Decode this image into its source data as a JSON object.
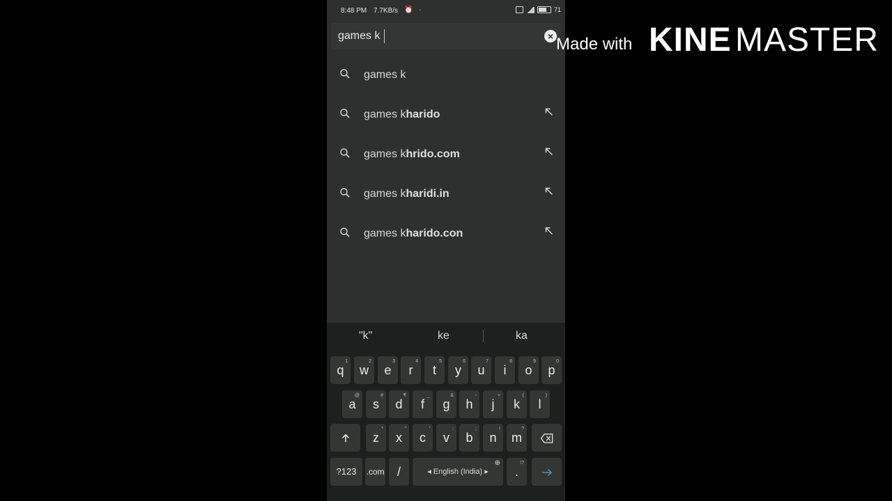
{
  "status_bar": {
    "time": "8:48 PM",
    "network_speed": "7.7KB/s",
    "battery": "71"
  },
  "search": {
    "query": "games k",
    "clear_icon": "close-circle-icon"
  },
  "suggestions": [
    {
      "prefix": "games k",
      "completion": "",
      "show_arrow": false
    },
    {
      "prefix": "games k",
      "completion": "harido",
      "show_arrow": true
    },
    {
      "prefix": "games k",
      "completion": "hrido.com",
      "show_arrow": true
    },
    {
      "prefix": "games k",
      "completion": "haridi.in",
      "show_arrow": true
    },
    {
      "prefix": "games k",
      "completion": "harido.con",
      "show_arrow": true
    }
  ],
  "keyboard": {
    "candidates": [
      "\"k\"",
      "ke",
      "ka"
    ],
    "row1": [
      {
        "key": "q",
        "sub": "1"
      },
      {
        "key": "w",
        "sub": "2"
      },
      {
        "key": "e",
        "sub": "3"
      },
      {
        "key": "r",
        "sub": "4"
      },
      {
        "key": "t",
        "sub": "5"
      },
      {
        "key": "y",
        "sub": "6"
      },
      {
        "key": "u",
        "sub": "7"
      },
      {
        "key": "i",
        "sub": "8"
      },
      {
        "key": "o",
        "sub": "9"
      },
      {
        "key": "p",
        "sub": "0"
      }
    ],
    "row2": [
      {
        "key": "a",
        "sub": "@"
      },
      {
        "key": "s",
        "sub": "#"
      },
      {
        "key": "d",
        "sub": "₹"
      },
      {
        "key": "f",
        "sub": "_"
      },
      {
        "key": "g",
        "sub": "&"
      },
      {
        "key": "h",
        "sub": "-"
      },
      {
        "key": "j",
        "sub": "+"
      },
      {
        "key": "k",
        "sub": "("
      },
      {
        "key": "l",
        "sub": ")"
      }
    ],
    "row3": [
      {
        "key": "z",
        "sub": "*"
      },
      {
        "key": "x",
        "sub": "\""
      },
      {
        "key": "c",
        "sub": "'"
      },
      {
        "key": "v",
        "sub": ":"
      },
      {
        "key": "b",
        "sub": ";"
      },
      {
        "key": "n",
        "sub": "!"
      },
      {
        "key": "m",
        "sub": "?"
      }
    ],
    "shift_icon": "shift-arrow-icon",
    "backspace_icon": "backspace-icon",
    "symbols_label": "?123",
    "com_label": ".com",
    "slash_label": "/",
    "space_label": "English (India)",
    "period_label": ".",
    "period_sub": "!?",
    "enter_icon": "enter-arrow-icon"
  },
  "watermark": {
    "made_with": "Made with",
    "kine": "KINE",
    "master": "MASTER"
  }
}
